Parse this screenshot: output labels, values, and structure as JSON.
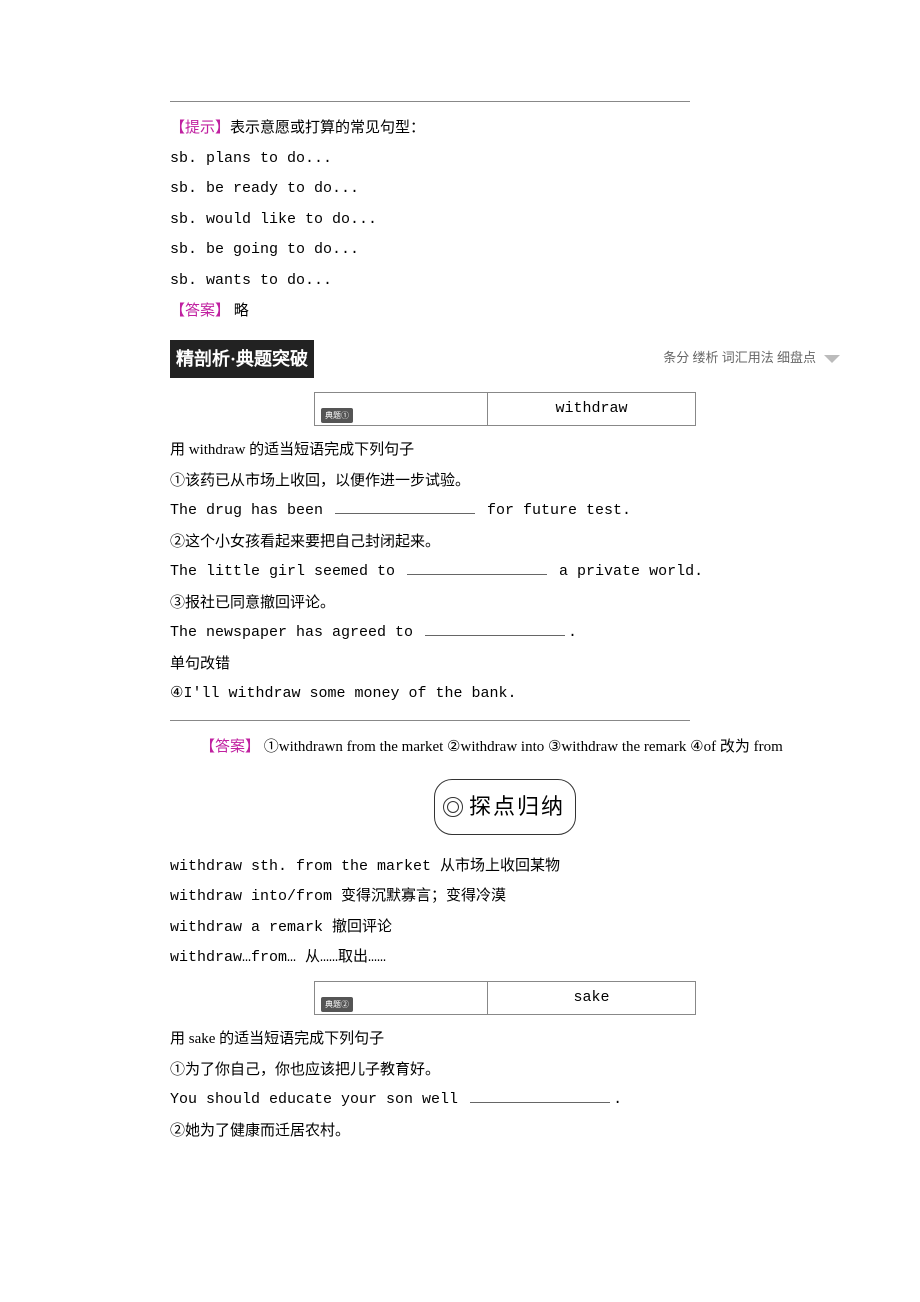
{
  "labels": {
    "hint": "【提示】",
    "answer": "【答案】"
  },
  "hint": {
    "title": "表示意愿或打算的常见句型：",
    "patterns": [
      "sb. plans to do...",
      "sb. be ready to do...",
      "sb. would like to do...",
      "sb. be going to do...",
      "sb. wants to do..."
    ],
    "answer_text": "   略"
  },
  "section_header": {
    "left": "精剖析·典题突破",
    "right": "条分 缕析 词汇用法 细盘点"
  },
  "box1": {
    "badge": "典题①",
    "word": "withdraw"
  },
  "q1": {
    "intro": "用 withdraw 的适当短语完成下列句子",
    "l1": "①该药已从市场上收回，以便作进一步试验。",
    "l1e_a": "The drug has been ",
    "l1e_b": " for future test.",
    "l2": "②这个小女孩看起来要把自己封闭起来。",
    "l2e_a": "The little girl seemed to ",
    "l2e_b": " a private world.",
    "l3": "③报社已同意撤回评论。",
    "l3e": "The newspaper has agreed to ",
    "l3e_end": ".",
    "err_title": "单句改错",
    "l4": "④I'll withdraw some money of the bank.",
    "ans": "   ①withdrawn from the market  ②withdraw into  ③withdraw the remark  ④of 改为 from"
  },
  "summary_label": "探点归纳",
  "summary1": [
    "withdraw sth. from the market 从市场上收回某物",
    "withdraw into/from 变得沉默寡言；变得冷漠",
    "withdraw a remark 撤回评论",
    "withdraw…from…  从……取出……"
  ],
  "box2": {
    "badge": "典题②",
    "word": "sake"
  },
  "q2": {
    "intro": "用 sake 的适当短语完成下列句子",
    "l1": "①为了你自己，你也应该把儿子教育好。",
    "l1e": "You should educate your son well ",
    "l1e_end": ".",
    "l2": "②她为了健康而迁居农村。"
  }
}
